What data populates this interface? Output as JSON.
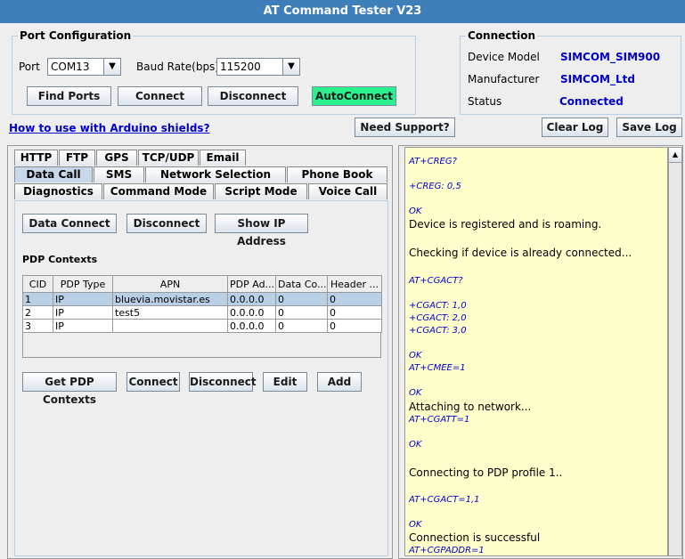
{
  "window": {
    "title": "AT Command Tester V23"
  },
  "port_config": {
    "title": "Port Configuration",
    "port_label": "Port",
    "port_value": "COM13",
    "baud_label": "Baud Rate(bps)",
    "baud_value": "115200",
    "find_ports": "Find Ports",
    "connect": "Connect",
    "disconnect": "Disconnect",
    "autoconnect": "AutoConnect"
  },
  "connection": {
    "title": "Connection",
    "device_model_label": "Device Model",
    "device_model_value": "SIMCOM_SIM900",
    "manufacturer_label": "Manufacturer",
    "manufacturer_value": "SIMCOM_Ltd",
    "status_label": "Status",
    "status_value": "Connected"
  },
  "toolbar": {
    "arduino_link": "How to use with Arduino shields?",
    "need_support": "Need Support?",
    "clear_log": "Clear Log",
    "save_log": "Save Log"
  },
  "tabs": {
    "row1": [
      "HTTP",
      "FTP",
      "GPS",
      "TCP/UDP",
      "Email"
    ],
    "row2": [
      "Data Call",
      "SMS",
      "Network Selection",
      "Phone Book"
    ],
    "row3": [
      "Diagnostics",
      "Command Mode",
      "Script Mode",
      "Voice Call"
    ],
    "selected": "Data Call"
  },
  "data_call": {
    "data_connect": "Data Connect",
    "disconnect": "Disconnect",
    "show_ip": "Show IP Address",
    "pdp_title": "PDP Contexts",
    "columns": [
      "CID",
      "PDP Type",
      "APN",
      "PDP Ad...",
      "Data Co...",
      "Header ..."
    ],
    "rows": [
      [
        "1",
        "IP",
        "bluevia.movistar.es",
        "0.0.0.0",
        "0",
        "0"
      ],
      [
        "2",
        "IP",
        "test5",
        "0.0.0.0",
        "0",
        "0"
      ],
      [
        "3",
        "IP",
        "",
        "0.0.0.0",
        "0",
        "0"
      ]
    ],
    "get_pdp": "Get PDP Contexts",
    "connect": "Connect",
    "disconnect2": "Disconnect",
    "edit": "Edit",
    "add": "Add"
  },
  "log": [
    {
      "type": "cmd",
      "text": "AT+CREG?"
    },
    {
      "type": "cmd",
      "text": "+CREG: 0,5"
    },
    {
      "type": "cmd",
      "text": "OK"
    },
    {
      "type": "msg",
      "text": "Device is registered and is roaming."
    },
    {
      "type": "msg",
      "text": "Checking if device is already connected..."
    },
    {
      "type": "cmd",
      "text": "AT+CGACT?"
    },
    {
      "type": "cmd",
      "text": "+CGACT: 1,0"
    },
    {
      "type": "cmd",
      "text": "+CGACT: 2,0"
    },
    {
      "type": "cmd",
      "text": "+CGACT: 3,0"
    },
    {
      "type": "cmd",
      "text": "OK"
    },
    {
      "type": "cmd",
      "text": "AT+CMEE=1"
    },
    {
      "type": "cmd",
      "text": "OK"
    },
    {
      "type": "msg",
      "text": "Attaching to network..."
    },
    {
      "type": "cmd",
      "text": "AT+CGATT=1"
    },
    {
      "type": "cmd",
      "text": "OK"
    },
    {
      "type": "msg",
      "text": "Connecting to PDP profile 1.."
    },
    {
      "type": "cmd",
      "text": "AT+CGACT=1,1"
    },
    {
      "type": "cmd",
      "text": "OK"
    },
    {
      "type": "msg",
      "text": "Connection is successful"
    },
    {
      "type": "cmd",
      "text": "AT+CGPADDR=1"
    }
  ]
}
